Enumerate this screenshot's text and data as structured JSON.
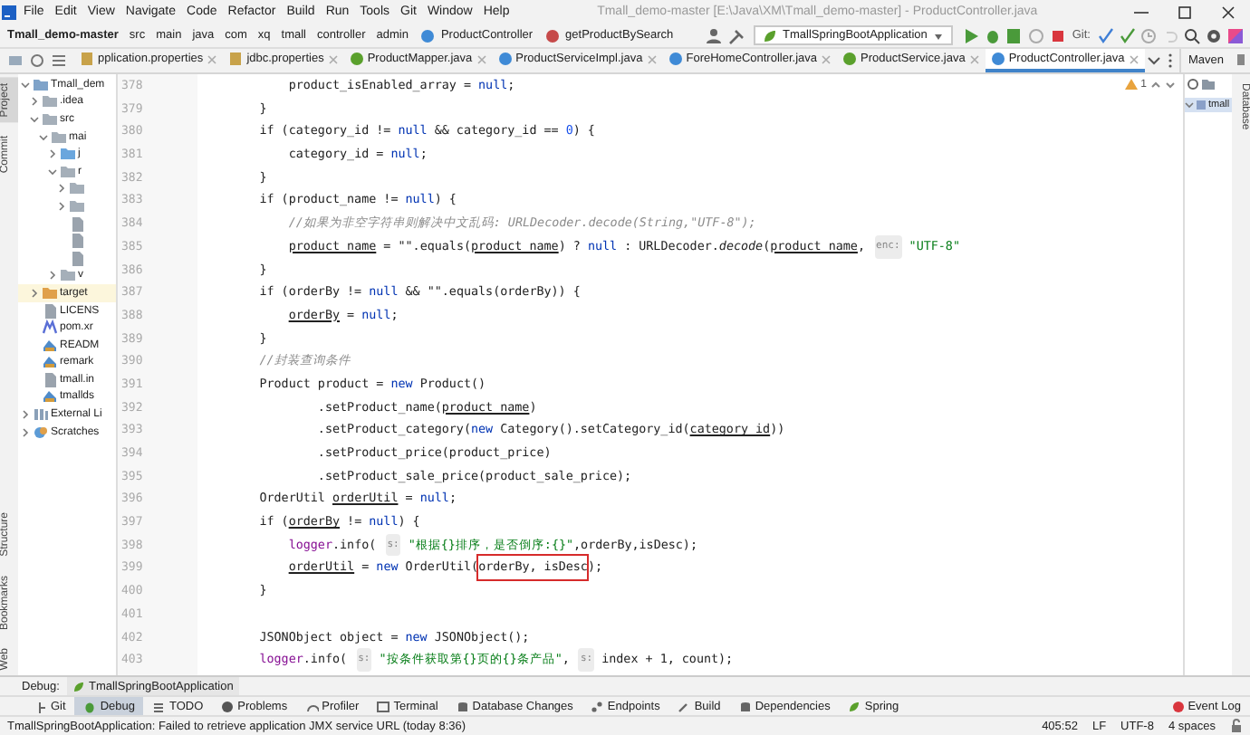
{
  "window": {
    "title": "Tmall_demo-master [E:\\Java\\XM\\Tmall_demo-master] - ProductController.java"
  },
  "menu": [
    "File",
    "Edit",
    "View",
    "Navigate",
    "Code",
    "Refactor",
    "Build",
    "Run",
    "Tools",
    "Git",
    "Window",
    "Help"
  ],
  "breadcrumbs": [
    {
      "label": "Tmall_demo-master",
      "kind": "project"
    },
    {
      "label": "src",
      "kind": "dir"
    },
    {
      "label": "main",
      "kind": "dir"
    },
    {
      "label": "java",
      "kind": "dir"
    },
    {
      "label": "com",
      "kind": "dir"
    },
    {
      "label": "xq",
      "kind": "dir"
    },
    {
      "label": "tmall",
      "kind": "dir"
    },
    {
      "label": "controller",
      "kind": "dir"
    },
    {
      "label": "admin",
      "kind": "dir"
    },
    {
      "label": "ProductController",
      "kind": "class"
    },
    {
      "label": "getProductBySearch",
      "kind": "method"
    }
  ],
  "run_config": "TmallSpringBootApplication",
  "git_label": "Git:",
  "tabs": [
    {
      "label": "pplication.properties",
      "kind": "props",
      "selected": false
    },
    {
      "label": "jdbc.properties",
      "kind": "props",
      "selected": false
    },
    {
      "label": "ProductMapper.java",
      "kind": "interface",
      "selected": false
    },
    {
      "label": "ProductServiceImpl.java",
      "kind": "class",
      "selected": false
    },
    {
      "label": "ForeHomeController.java",
      "kind": "class",
      "selected": false
    },
    {
      "label": "ProductService.java",
      "kind": "interface",
      "selected": false
    },
    {
      "label": "ProductController.java",
      "kind": "class",
      "selected": true
    }
  ],
  "side_stripe": [
    {
      "label": "Project",
      "selected": true
    },
    {
      "label": "Commit",
      "selected": false
    },
    {
      "label": "Structure",
      "selected": false
    },
    {
      "label": "Bookmarks",
      "selected": false
    },
    {
      "label": "Web",
      "selected": false
    }
  ],
  "project_tree": [
    {
      "label": "Tmall_dem",
      "kind": "module",
      "expanded": true,
      "children": [
        {
          "label": ".idea",
          "kind": "folder",
          "expanded": false
        },
        {
          "label": "src",
          "kind": "folder",
          "expanded": true,
          "children": [
            {
              "label": "mai",
              "kind": "folder",
              "expanded": true,
              "children": [
                {
                  "label": "j",
                  "kind": "source",
                  "expanded": false
                },
                {
                  "label": "r",
                  "kind": "folder",
                  "expanded": true,
                  "children": [
                    {
                      "kind": "folder",
                      "expanded": false
                    },
                    {
                      "kind": "folder",
                      "expanded": false
                    },
                    {
                      "kind": "file"
                    },
                    {
                      "kind": "file"
                    },
                    {
                      "kind": "file"
                    }
                  ]
                },
                {
                  "label": "v",
                  "kind": "folder",
                  "expanded": false
                }
              ]
            }
          ]
        },
        {
          "label": "target",
          "kind": "excluded",
          "expanded": false,
          "selected": true
        },
        {
          "label": "LICENS",
          "kind": "file",
          "selected": false
        },
        {
          "label": "pom.xr",
          "kind": "maven",
          "selected": false
        },
        {
          "label": "READM",
          "kind": "markdown",
          "selected": false
        },
        {
          "label": "remark",
          "kind": "markdown",
          "selected": false
        },
        {
          "label": "tmall.in",
          "kind": "file",
          "selected": false
        },
        {
          "label": "tmallds",
          "kind": "markdown",
          "selected": false
        }
      ]
    },
    {
      "label": "External Li",
      "kind": "library",
      "expanded": false
    },
    {
      "label": "Scratches",
      "kind": "scratch",
      "expanded": false
    }
  ],
  "inspection": {
    "warnings": "1"
  },
  "code": {
    "lines": [
      {
        "number": "378",
        "tokens": [
          {
            "text": "            product_isEnabled_array = ",
            "kind": "plain"
          },
          {
            "text": "null",
            "kind": "keyword"
          },
          {
            "text": ";",
            "kind": "plain"
          }
        ]
      },
      {
        "number": "379",
        "tokens": [
          {
            "text": "        }",
            "kind": "plain"
          }
        ]
      },
      {
        "number": "380",
        "tokens": [
          {
            "text": "        if (category_id != ",
            "kind": "plain"
          },
          {
            "text": "null",
            "kind": "keyword"
          },
          {
            "text": " && category_id == ",
            "kind": "plain"
          },
          {
            "text": "0",
            "kind": "number"
          },
          {
            "text": ") {",
            "kind": "plain"
          }
        ]
      },
      {
        "number": "381",
        "tokens": [
          {
            "text": "            category_id = ",
            "kind": "plain"
          },
          {
            "text": "null",
            "kind": "keyword"
          },
          {
            "text": ";",
            "kind": "plain"
          }
        ]
      },
      {
        "number": "382",
        "tokens": [
          {
            "text": "        }",
            "kind": "plain"
          }
        ]
      },
      {
        "number": "383",
        "tokens": [
          {
            "text": "        if (product_name != ",
            "kind": "plain"
          },
          {
            "text": "null",
            "kind": "keyword"
          },
          {
            "text": ") {",
            "kind": "plain"
          }
        ]
      },
      {
        "number": "384",
        "tokens": [
          {
            "text": "            //如果为非空字符串则解决中文乱码: URLDecoder.decode(String,\"UTF-8\");",
            "kind": "comment"
          }
        ]
      },
      {
        "number": "385",
        "tokens": [
          {
            "text": "            product_name",
            "kind": "reassigned"
          },
          {
            "text": " = \"\".equals(",
            "kind": "plain"
          },
          {
            "text": "product_name",
            "kind": "reassigned"
          },
          {
            "text": ") ? ",
            "kind": "plain"
          },
          {
            "text": "null",
            "kind": "keyword"
          },
          {
            "text": " : URLDecoder.",
            "kind": "plain"
          },
          {
            "text": "decode",
            "kind": "static"
          },
          {
            "text": "(",
            "kind": "plain"
          },
          {
            "text": "product_name",
            "kind": "reassigned"
          },
          {
            "text": ", ",
            "kind": "plain"
          },
          {
            "text": "enc:",
            "kind": "hint"
          },
          {
            "text": " \"UTF-8\"",
            "kind": "string"
          }
        ]
      },
      {
        "number": "386",
        "tokens": [
          {
            "text": "        }",
            "kind": "plain"
          }
        ]
      },
      {
        "number": "387",
        "tokens": [
          {
            "text": "        if (orderBy != ",
            "kind": "plain"
          },
          {
            "text": "null",
            "kind": "keyword"
          },
          {
            "text": " && \"\".equals(orderBy)) {",
            "kind": "plain"
          }
        ]
      },
      {
        "number": "388",
        "tokens": [
          {
            "text": "            orderBy",
            "kind": "reassigned"
          },
          {
            "text": " = ",
            "kind": "plain"
          },
          {
            "text": "null",
            "kind": "keyword"
          },
          {
            "text": ";",
            "kind": "plain"
          }
        ]
      },
      {
        "number": "389",
        "tokens": [
          {
            "text": "        }",
            "kind": "plain"
          }
        ]
      },
      {
        "number": "390",
        "tokens": [
          {
            "text": "        //封装查询条件",
            "kind": "comment"
          }
        ]
      },
      {
        "number": "391",
        "tokens": [
          {
            "text": "        Product product = ",
            "kind": "plain"
          },
          {
            "text": "new",
            "kind": "keyword"
          },
          {
            "text": " Product()",
            "kind": "plain"
          }
        ]
      },
      {
        "number": "392",
        "tokens": [
          {
            "text": "                .setProduct_name(",
            "kind": "plain"
          },
          {
            "text": "product_name",
            "kind": "reassigned"
          },
          {
            "text": ")",
            "kind": "plain"
          }
        ]
      },
      {
        "number": "393",
        "tokens": [
          {
            "text": "                .setProduct_category(",
            "kind": "plain"
          },
          {
            "text": "new",
            "kind": "keyword"
          },
          {
            "text": " Category().setCategory_id(",
            "kind": "plain"
          },
          {
            "text": "category_id",
            "kind": "reassigned"
          },
          {
            "text": "))",
            "kind": "plain"
          }
        ]
      },
      {
        "number": "394",
        "tokens": [
          {
            "text": "                .setProduct_price(product_price)",
            "kind": "plain"
          }
        ]
      },
      {
        "number": "395",
        "tokens": [
          {
            "text": "                .setProduct_sale_price(product_sale_price);",
            "kind": "plain"
          }
        ]
      },
      {
        "number": "396",
        "tokens": [
          {
            "text": "        OrderUtil ",
            "kind": "plain"
          },
          {
            "text": "orderUtil",
            "kind": "reassigned"
          },
          {
            "text": " = ",
            "kind": "plain"
          },
          {
            "text": "null",
            "kind": "keyword"
          },
          {
            "text": ";",
            "kind": "plain"
          }
        ]
      },
      {
        "number": "397",
        "tokens": [
          {
            "text": "        if (",
            "kind": "plain"
          },
          {
            "text": "orderBy",
            "kind": "reassigned"
          },
          {
            "text": " != ",
            "kind": "plain"
          },
          {
            "text": "null",
            "kind": "keyword"
          },
          {
            "text": ") {",
            "kind": "plain"
          }
        ]
      },
      {
        "number": "398",
        "tokens": [
          {
            "text": "            logger",
            "kind": "field"
          },
          {
            "text": ".info( ",
            "kind": "plain"
          },
          {
            "text": "s:",
            "kind": "hint"
          },
          {
            "text": " \"根据{}排序，是否倒序:{}\"",
            "kind": "string"
          },
          {
            "text": ",orderBy,isDesc);",
            "kind": "plain"
          }
        ]
      },
      {
        "number": "399",
        "tokens": [
          {
            "text": "            orderUtil",
            "kind": "reassigned"
          },
          {
            "text": " = ",
            "kind": "plain"
          },
          {
            "text": "new",
            "kind": "keyword"
          },
          {
            "text": " OrderUtil(",
            "kind": "plain"
          },
          {
            "text": "orderBy, isDesc",
            "kind": "boxed"
          },
          {
            "text": ");",
            "kind": "plain"
          }
        ]
      },
      {
        "number": "400",
        "tokens": [
          {
            "text": "        }",
            "kind": "plain"
          }
        ]
      },
      {
        "number": "401"
      },
      {
        "number": "402",
        "tokens": [
          {
            "text": "        JSONObject object = ",
            "kind": "plain"
          },
          {
            "text": "new",
            "kind": "keyword"
          },
          {
            "text": " JSONObject();",
            "kind": "plain"
          }
        ]
      },
      {
        "number": "403",
        "tokens": [
          {
            "text": "        logger",
            "kind": "field"
          },
          {
            "text": ".info( ",
            "kind": "plain"
          },
          {
            "text": "s:",
            "kind": "hint"
          },
          {
            "text": " \"按条件获取第{}页的{}条产品\"",
            "kind": "string"
          },
          {
            "text": ", ",
            "kind": "plain"
          },
          {
            "text": "s:",
            "kind": "hint"
          },
          {
            "text": " index + 1, count);",
            "kind": "plain"
          }
        ]
      }
    ]
  },
  "maven": {
    "title": "Maven",
    "items": [
      {
        "label": "tmall",
        "expanded": true
      }
    ]
  },
  "right_stripe": [
    {
      "label": "Database",
      "selected": false
    }
  ],
  "debug_bar": {
    "label": "Debug:",
    "session": "TmallSpringBootApplication"
  },
  "tool_tabs": [
    {
      "label": "Git",
      "kind": "git",
      "selected": false
    },
    {
      "label": "Debug",
      "kind": "debug",
      "selected": true
    },
    {
      "label": "TODO",
      "kind": "list",
      "selected": false
    },
    {
      "label": "Problems",
      "kind": "info",
      "selected": false
    },
    {
      "label": "Profiler",
      "kind": "gauge",
      "selected": false
    },
    {
      "label": "Terminal",
      "kind": "terminal",
      "selected": false
    },
    {
      "label": "Database Changes",
      "kind": "db",
      "selected": false
    },
    {
      "label": "Endpoints",
      "kind": "nodes",
      "selected": false
    },
    {
      "label": "Build",
      "kind": "hammer",
      "selected": false
    },
    {
      "label": "Dependencies",
      "kind": "db",
      "selected": false
    },
    {
      "label": "Spring",
      "kind": "leaf",
      "selected": false
    }
  ],
  "event_log": {
    "label": "Event Log"
  },
  "status_bar": {
    "message": "TmallSpringBootApplication: Failed to retrieve application JMX service URL (today 8:36)",
    "position": "405:52",
    "line_separator": "LF",
    "encoding": "UTF-8",
    "indent": "4 spaces"
  }
}
